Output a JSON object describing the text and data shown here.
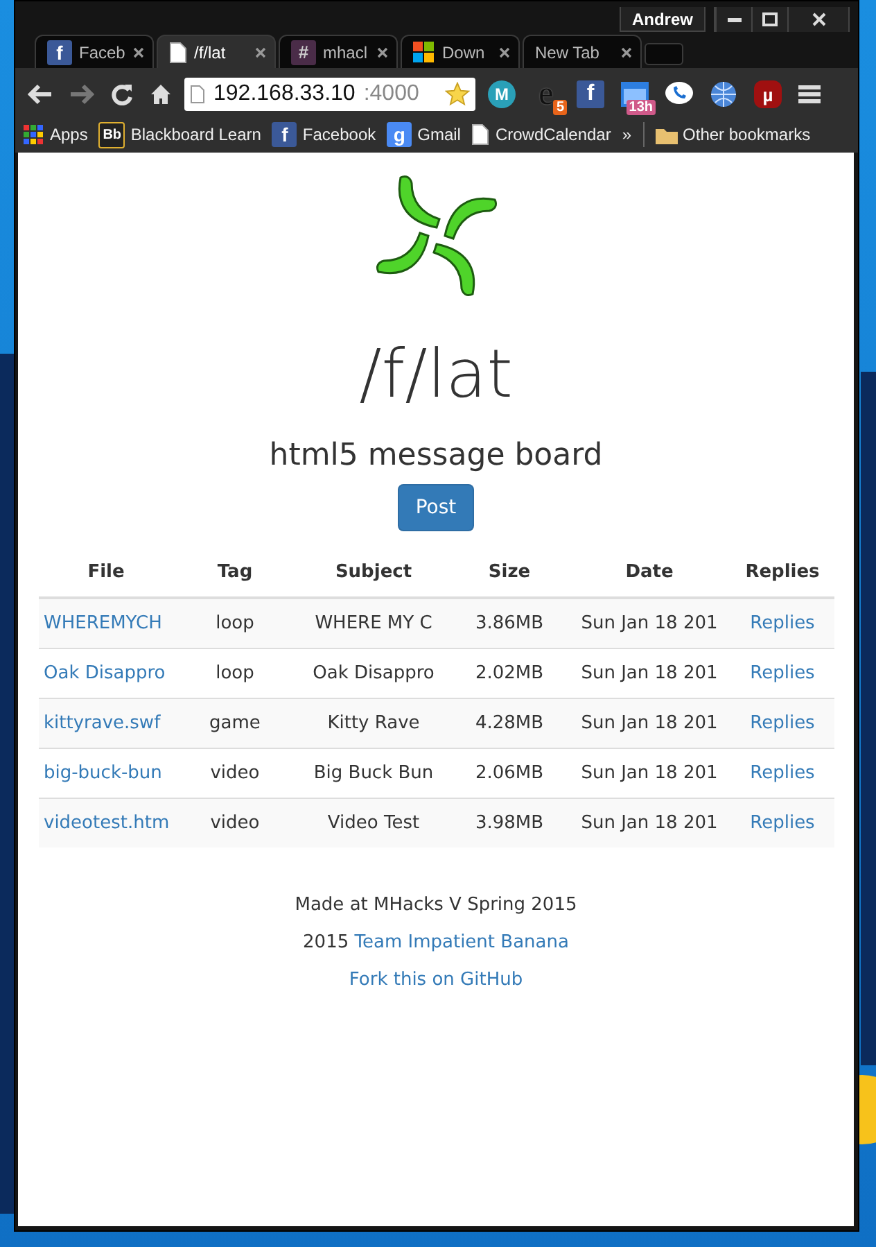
{
  "browser": {
    "profile": "Andrew",
    "tabs": [
      {
        "label": "Faceb",
        "kind": "square",
        "glyph": "f",
        "selected": false
      },
      {
        "label": "/f/lat",
        "kind": "page",
        "selected": true
      },
      {
        "label": "mhacl",
        "kind": "hash",
        "glyph": "#",
        "selected": false
      },
      {
        "label": "Down",
        "kind": "windows",
        "selected": false
      },
      {
        "label": "New Tab",
        "kind": "none",
        "selected": false
      }
    ],
    "address": {
      "host": "192.168.33.10",
      "port": ":4000"
    },
    "extensions": [
      {
        "kind": "cloud",
        "glyph": "M"
      },
      {
        "kind": "e",
        "glyph": "e",
        "badge": "5"
      },
      {
        "kind": "square",
        "glyph": "f"
      },
      {
        "kind": "calendar",
        "badge": "13h"
      },
      {
        "kind": "phone"
      },
      {
        "kind": "globe"
      },
      {
        "kind": "stop",
        "glyph": "µ"
      }
    ],
    "bookmarks": [
      {
        "label": "Apps",
        "kind": "apps"
      },
      {
        "label": "Blackboard Learn",
        "kind": "bb",
        "glyph": "Bb"
      },
      {
        "label": "Facebook",
        "kind": "square",
        "glyph": "f"
      },
      {
        "label": "Gmail",
        "kind": "g",
        "glyph": "g"
      },
      {
        "label": "CrowdCalendar",
        "kind": "page"
      }
    ],
    "overflow": "»",
    "other_bookmarks": "Other bookmarks"
  },
  "page": {
    "title": "/f/lat",
    "subtitle": "html5 message board",
    "post_button": "Post",
    "table": {
      "columns": [
        "File",
        "Tag",
        "Subject",
        "Size",
        "Date",
        "Replies"
      ],
      "rows": [
        {
          "file": "WHEREMYCH",
          "tag": "loop",
          "subject": "WHERE MY C",
          "size": "3.86MB",
          "date": "Sun Jan 18 201",
          "replies": "Replies"
        },
        {
          "file": "Oak Disappro",
          "tag": "loop",
          "subject": "Oak Disappro",
          "size": "2.02MB",
          "date": "Sun Jan 18 201",
          "replies": "Replies"
        },
        {
          "file": "kittyrave.swf",
          "tag": "game",
          "subject": "Kitty Rave",
          "size": "4.28MB",
          "date": "Sun Jan 18 201",
          "replies": "Replies"
        },
        {
          "file": "big-buck-bun",
          "tag": "video",
          "subject": "Big Buck Bun",
          "size": "2.06MB",
          "date": "Sun Jan 18 201",
          "replies": "Replies"
        },
        {
          "file": "videotest.htm",
          "tag": "video",
          "subject": "Video Test",
          "size": "3.98MB",
          "date": "Sun Jan 18 201",
          "replies": "Replies"
        }
      ]
    },
    "footer": {
      "made": "Made at MHacks V Spring 2015",
      "year": "2015",
      "team": "Team Impatient Banana",
      "fork": "Fork this on GitHub"
    }
  }
}
